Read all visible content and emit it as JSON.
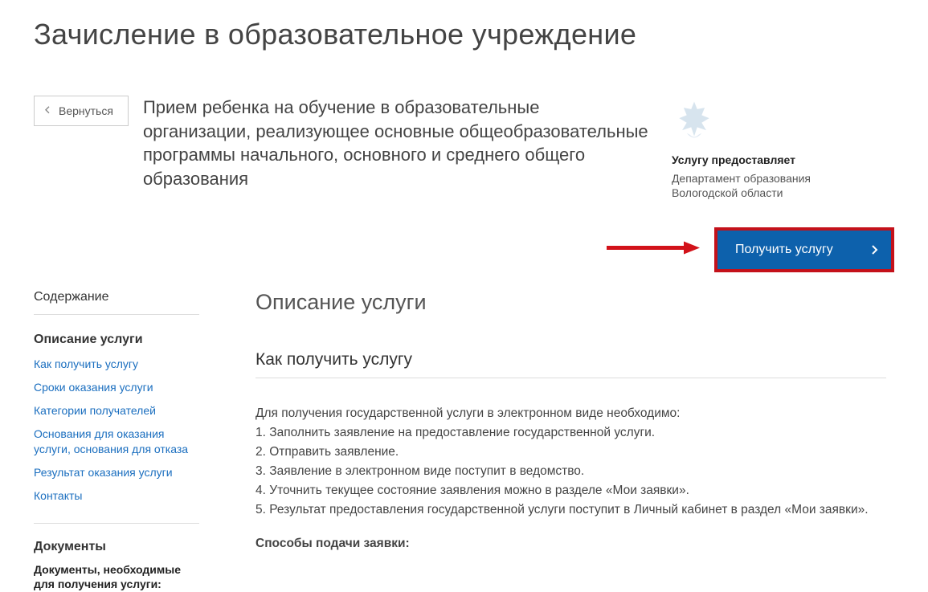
{
  "page_title": "Зачисление в образовательное учреждение",
  "back_label": "Вернуться",
  "lead": "Прием ребенка на обучение в образовательные организации, реализующее основные общеобразовательные программы начального, основного и среднего общего образования",
  "provider": {
    "heading": "Услугу предоставляет",
    "name": "Департамент образования Вологодской области"
  },
  "cta_label": "Получить услугу",
  "toc": {
    "heading": "Содержание",
    "section": "Описание услуги",
    "items": [
      "Как получить услугу",
      "Сроки оказания услуги",
      "Категории получателей",
      "Основания для оказания услуги, основания для отказа",
      "Результат оказания услуги",
      "Контакты"
    ],
    "docs_heading": "Документы",
    "docs_line": "Документы, необходимые для получения услуги:"
  },
  "content": {
    "h2": "Описание услуги",
    "h3": "Как получить услугу",
    "intro": "Для получения государственной услуги в электронном виде необходимо:",
    "steps": [
      "Заполнить заявление на предоставление государственной услуги.",
      "Отправить заявление.",
      "Заявление в электронном виде поступит в ведомство.",
      "Уточнить текущее состояние заявления можно в разделе «Мои заявки».",
      "Результат предоставления государственной услуги поступит в Личный кабинет в раздел «Мои заявки»."
    ],
    "sub": "Способы подачи заявки:"
  }
}
